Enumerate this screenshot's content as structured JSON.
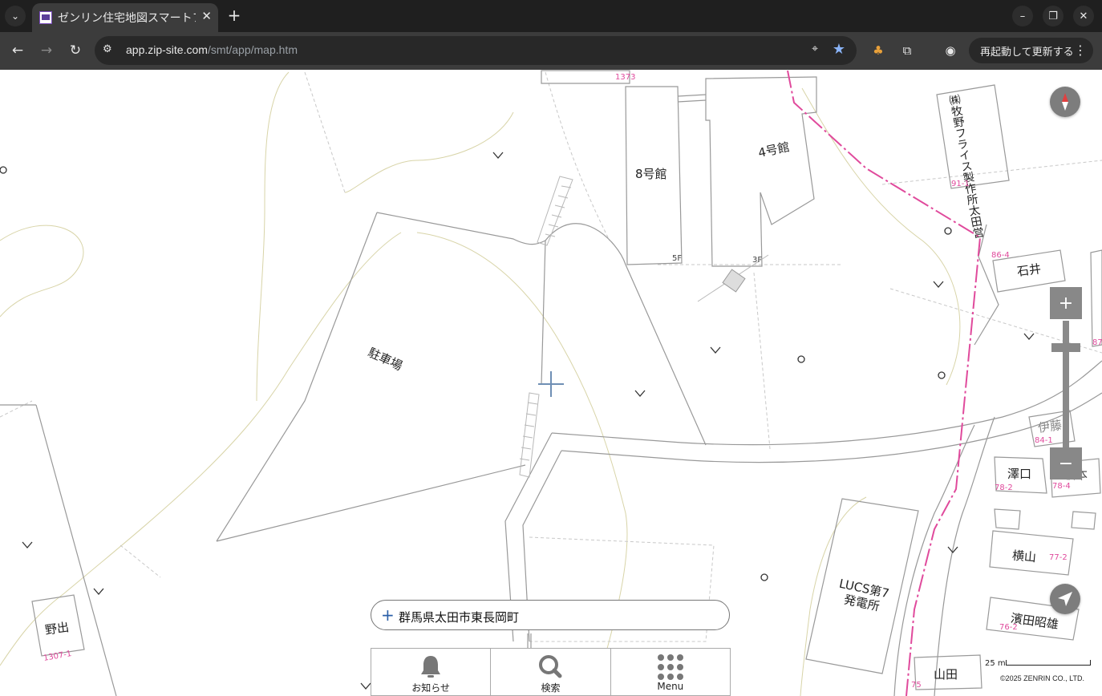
{
  "browser": {
    "tab_title": "ゼンリン住宅地図スマートフォン",
    "url_host": "app.zip-site.com",
    "url_path": "/smt/app/map.htm",
    "restart_label": "再起動して更新する"
  },
  "map": {
    "labels": {
      "building8": "8号館",
      "building4": "4号館",
      "parking": "駐車場",
      "company": "㈱牧野フライス製作所太田営",
      "ishii": "石井",
      "ito": "伊藤",
      "sawaguchi": "澤口",
      "sakamoto": "坂本",
      "yokoyama": "横山",
      "hamada": "濱田昭雄",
      "yamada": "山田",
      "noide": "野出",
      "lucs": "LUCS第7",
      "lucs2": "発電所"
    },
    "lot_numbers": {
      "n1373": "1373",
      "n5f": "5F",
      "n3f": "3F",
      "n91": "91-1",
      "n864": "86-4",
      "n87": "87",
      "n841": "84-1",
      "n782": "78-2",
      "n784": "78-4",
      "n772": "77-2",
      "n762": "76-2",
      "n75": "75",
      "n13071": "1307-1"
    },
    "colors": {
      "railway": "#e04a9c",
      "road": "#888888",
      "contour": "#d8d4a8"
    }
  },
  "controls": {
    "zoom_in": "+",
    "zoom_out": "−",
    "address": "群馬県太田市東長岡町",
    "nav": [
      {
        "label": "お知らせ",
        "icon": "bell-icon"
      },
      {
        "label": "検索",
        "icon": "search-icon"
      },
      {
        "label": "Menu",
        "icon": "grid-icon"
      }
    ],
    "scale_label": "25 m",
    "copyright": "©2025 ZENRIN CO., LTD."
  }
}
